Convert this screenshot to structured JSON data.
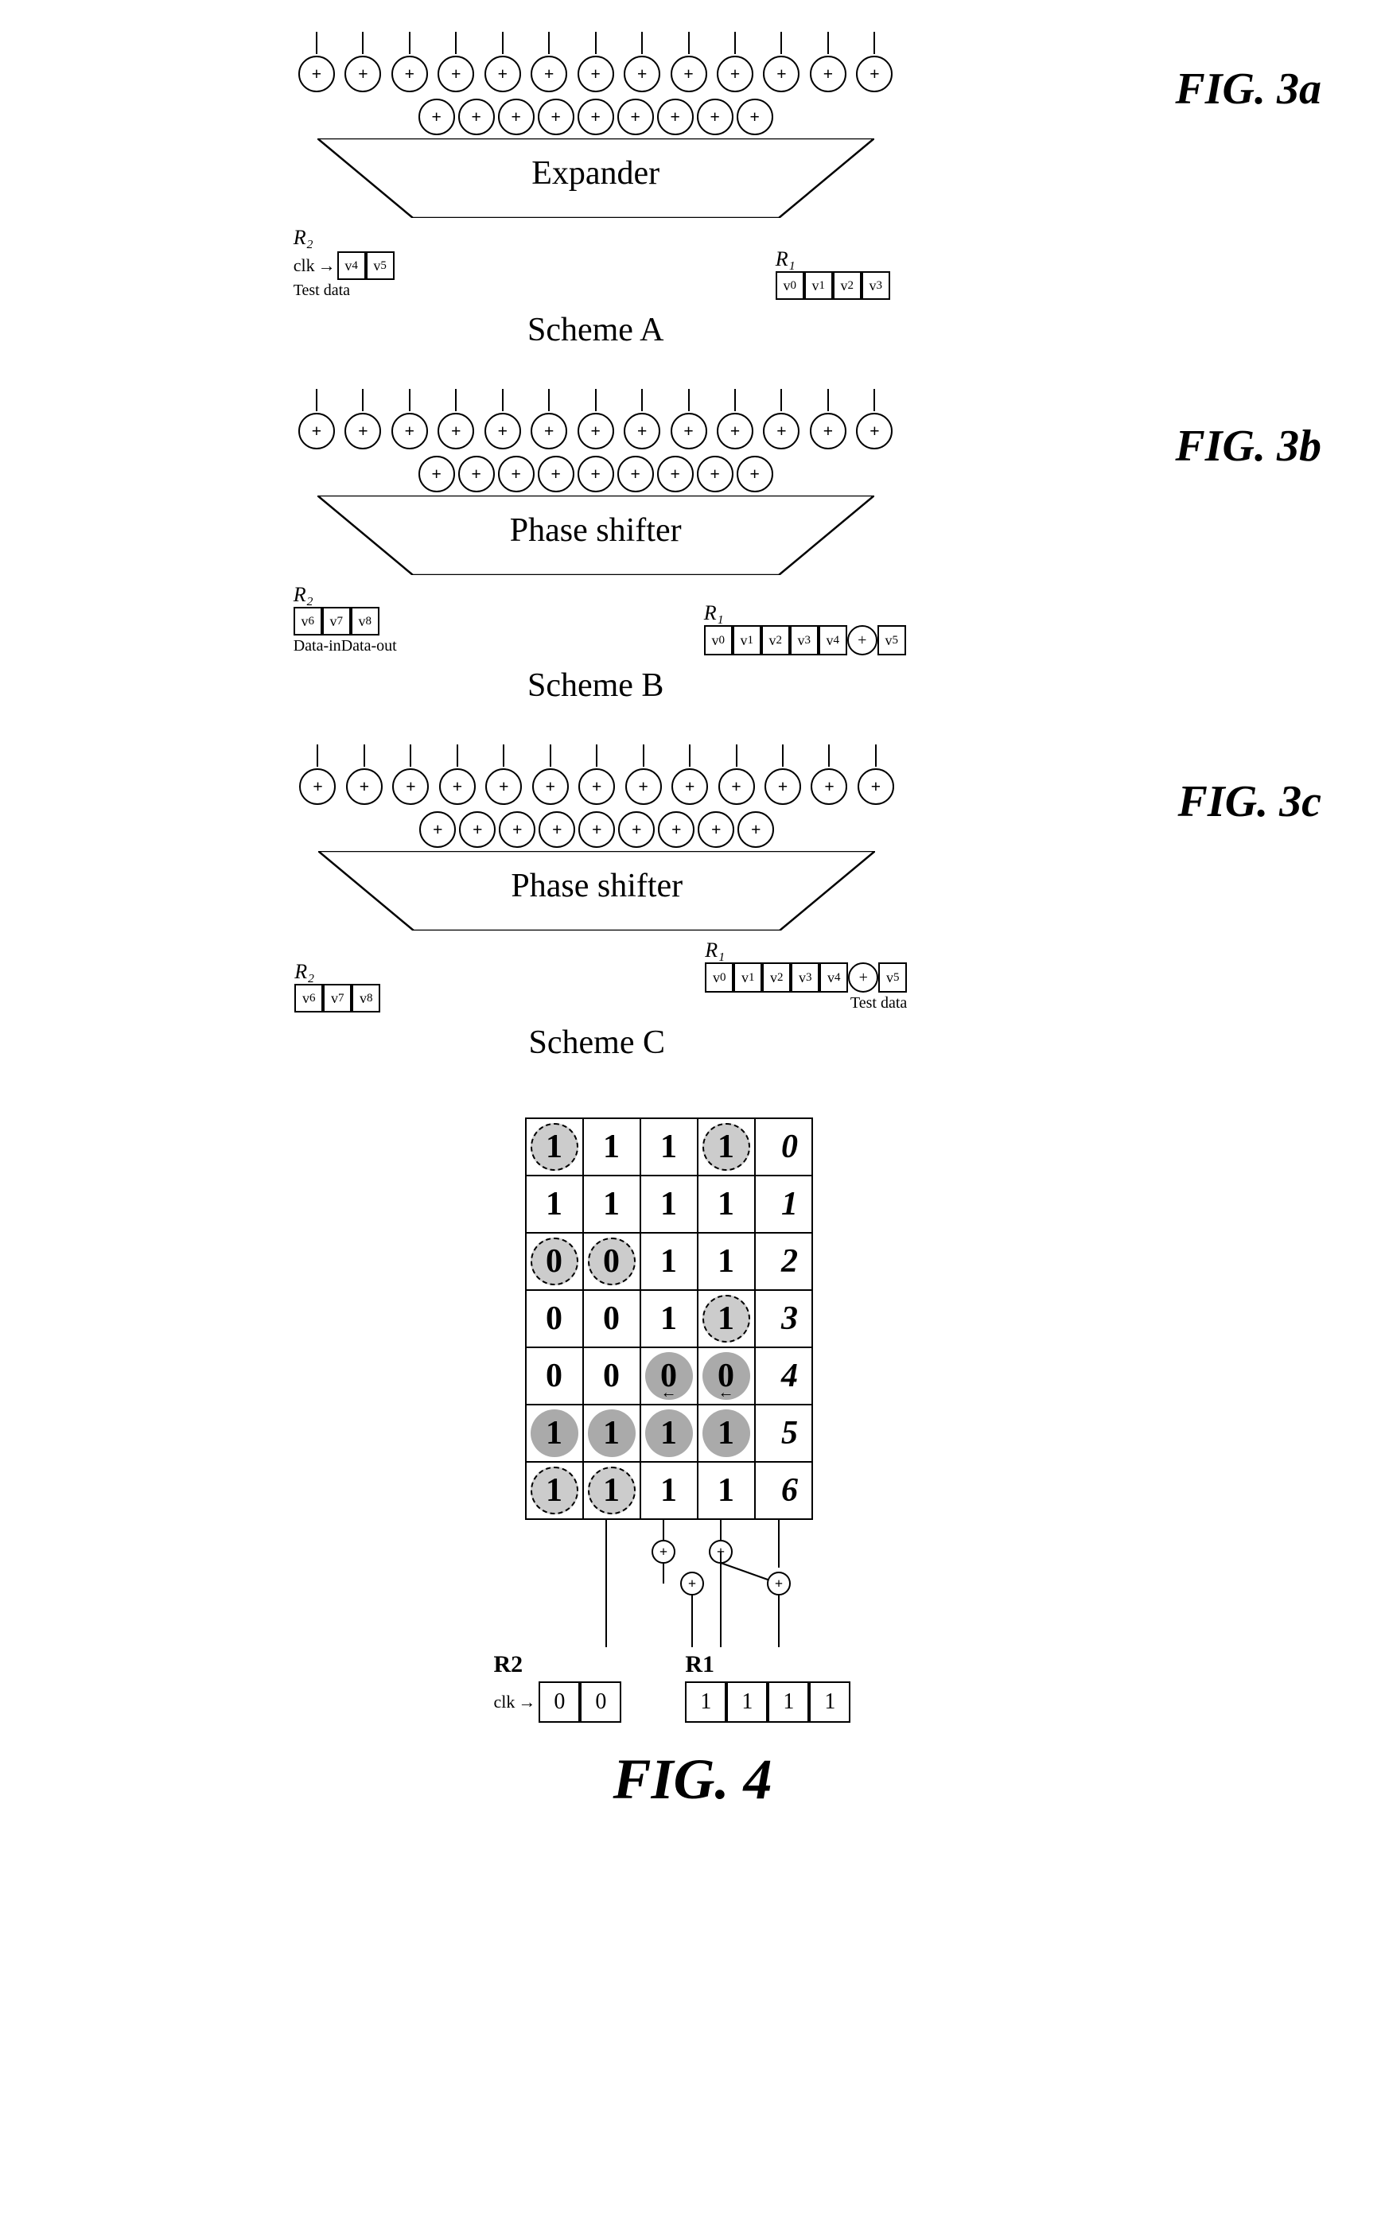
{
  "figures": {
    "fig3a": {
      "label": "FIG. 3a",
      "box_label": "Expander",
      "scheme_label": "Scheme A",
      "r2_label": "R₂",
      "r1_label": "R₁",
      "clk_label": "clk",
      "test_data_label": "Test data",
      "r2_cells": [
        "v₄",
        "v₅"
      ],
      "r1_cells": [
        "v₀",
        "v₁",
        "v₂",
        "v₃"
      ]
    },
    "fig3b": {
      "label": "FIG. 3b",
      "box_label": "Phase shifter",
      "scheme_label": "Scheme B",
      "r2_label": "R₂",
      "r1_label": "R₁",
      "data_in_label": "Data-in",
      "data_out_label": "Data-out",
      "r2_cells": [
        "v₆",
        "v₇",
        "v₈"
      ],
      "r1_cells": [
        "v₀",
        "v₁",
        "v₂",
        "v₃",
        "v₄",
        "+",
        "v₅"
      ]
    },
    "fig3c": {
      "label": "FIG. 3c",
      "box_label": "Phase shifter",
      "scheme_label": "Scheme C",
      "r2_label": "R₂",
      "r1_label": "R₁",
      "test_data_label": "Test data",
      "r2_cells": [
        "v₆",
        "v₇",
        "v₈"
      ],
      "r1_cells": [
        "v₀",
        "v₁",
        "v₂",
        "v₃",
        "v₄",
        "+",
        "v₅"
      ]
    },
    "fig4": {
      "label": "FIG. 4",
      "matrix": [
        {
          "row_index": "0",
          "cells": [
            "1c",
            "1",
            "1",
            "1c"
          ]
        },
        {
          "row_index": "1",
          "cells": [
            "1",
            "1",
            "1",
            "1"
          ]
        },
        {
          "row_index": "2",
          "cells": [
            "0c",
            "0c",
            "1",
            "1"
          ]
        },
        {
          "row_index": "3",
          "cells": [
            "0",
            "0",
            "1",
            "1b"
          ]
        },
        {
          "row_index": "4",
          "cells": [
            "0",
            "0",
            "0g",
            "0g"
          ]
        },
        {
          "row_index": "5",
          "cells": [
            "1g",
            "1g",
            "1g",
            "1g"
          ]
        },
        {
          "row_index": "6",
          "cells": [
            "1c",
            "1c",
            "1",
            "1"
          ]
        }
      ],
      "r2_label": "R2",
      "r1_label": "R1",
      "clk_label": "clk",
      "r2_cells": [
        "0",
        "0"
      ],
      "r1_cells": [
        "1",
        "1",
        "1",
        "1"
      ]
    }
  }
}
